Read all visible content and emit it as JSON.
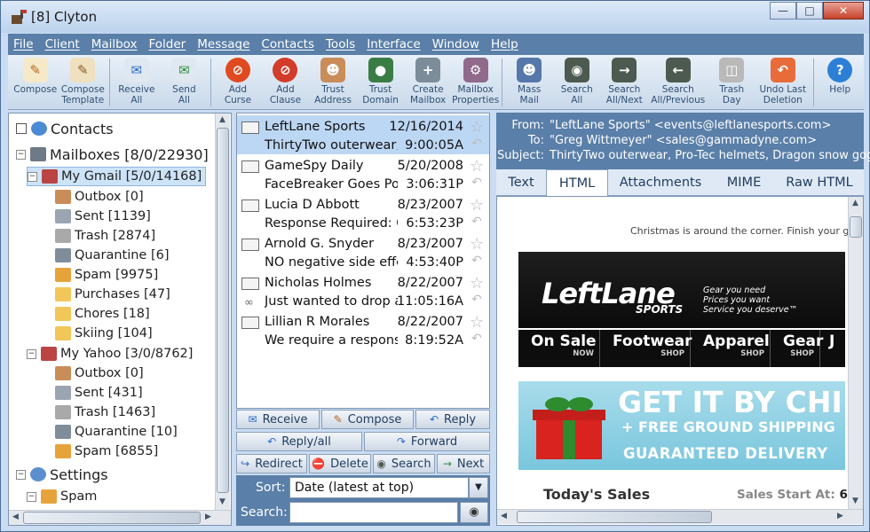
{
  "window": {
    "title": "[8] Clyton"
  },
  "menu": [
    "File",
    "Client",
    "Mailbox",
    "Folder",
    "Message",
    "Contacts",
    "Tools",
    "Interface",
    "Window",
    "Help"
  ],
  "toolbar": [
    {
      "label": "Compose",
      "icon": "compose-icon"
    },
    {
      "label": "Compose\nTemplate",
      "icon": "compose-template-icon"
    },
    {
      "label": "Receive\nAll",
      "icon": "receive-all-icon"
    },
    {
      "label": "Send\nAll",
      "icon": "send-all-icon"
    },
    {
      "label": "Add\nCurse",
      "icon": "add-curse-icon"
    },
    {
      "label": "Add\nClause",
      "icon": "add-clause-icon"
    },
    {
      "label": "Trust\nAddress",
      "icon": "trust-address-icon"
    },
    {
      "label": "Trust\nDomain",
      "icon": "trust-domain-icon"
    },
    {
      "label": "Create\nMailbox",
      "icon": "create-mailbox-icon"
    },
    {
      "label": "Mailbox\nProperties",
      "icon": "mailbox-properties-icon"
    },
    {
      "label": "Mass\nMail",
      "icon": "mass-mail-icon"
    },
    {
      "label": "Search\nAll",
      "icon": "search-all-icon"
    },
    {
      "label": "Search\nAll/Next",
      "icon": "search-next-icon"
    },
    {
      "label": "Search\nAll/Previous",
      "icon": "search-previous-icon"
    },
    {
      "label": "Trash\nDay",
      "icon": "trash-day-icon"
    },
    {
      "label": "Undo Last\nDeletion",
      "icon": "undo-deletion-icon"
    },
    {
      "label": "Help",
      "icon": "help-icon"
    }
  ],
  "tree": {
    "contacts": "Contacts",
    "mailboxes": "Mailboxes [8/0/22930]",
    "gmail": "My Gmail [5/0/14168]",
    "gmail_folders": [
      "Outbox [0]",
      "Sent [1139]",
      "Trash [2874]",
      "Quarantine [6]",
      "Spam [9975]",
      "Purchases [47]",
      "Chores [18]",
      "Skiing [104]"
    ],
    "yahoo": "My Yahoo [3/0/8762]",
    "yahoo_folders": [
      "Outbox [0]",
      "Sent [431]",
      "Trash [1463]",
      "Quarantine [10]",
      "Spam [6855]"
    ],
    "settings": "Settings",
    "settings_children": [
      "Spam"
    ]
  },
  "messages": [
    {
      "from": "LeftLane Sports",
      "date": "12/16/2014",
      "subject": "ThirtyTwo outerwear, Pro",
      "time": "9:00:05A"
    },
    {
      "from": "GameSpy Daily",
      "date": "5/20/2008",
      "subject": "FaceBreaker Goes Pow! R",
      "time": "3:06:31P"
    },
    {
      "from": "Lucia D Abbott",
      "date": "8/23/2007",
      "subject": "Response Required: Case",
      "time": "6:53:23P"
    },
    {
      "from": "Arnold G. Snyder",
      "date": "8/23/2007",
      "subject": "NO negative side effects",
      "time": "4:53:40P"
    },
    {
      "from": "Nicholas Holmes",
      "date": "8/22/2007",
      "subject": "Just wanted to drop a li",
      "time": "11:05:16A"
    },
    {
      "from": "Lillian R Morales",
      "date": "8/22/2007",
      "subject": "We require a response: R",
      "time": "8:19:52A"
    }
  ],
  "actions": {
    "receive": "Receive",
    "compose": "Compose",
    "reply": "Reply",
    "replyall": "Reply/all",
    "forward": "Forward",
    "redirect": "Redirect",
    "delete": "Delete",
    "search": "Search",
    "next": "Next"
  },
  "sort": {
    "label": "Sort:",
    "value": "Date (latest at top)",
    "search_label": "Search:"
  },
  "header": {
    "from_label": "From:",
    "from": "\"LeftLane Sports\" <events@leftlanesports.com>",
    "to_label": "To:",
    "to": "\"Greg Wittmeyer\" <sales@gammadyne.com>",
    "subject_label": "Subject:",
    "subject": "ThirtyTwo outerwear, Pro-Tec helmets, Dragon snow goggles"
  },
  "tabs": [
    "Text",
    "HTML",
    "Attachments",
    "MIME",
    "Raw HTML"
  ],
  "email": {
    "christmas": "Christmas is around the corner. Finish your gift sh",
    "logo": "LeftLane",
    "logo_sub": "SPORTS",
    "tag1": "Gear you need",
    "tag2": "Prices you want",
    "tag3": "Service you deserve™",
    "nav": [
      {
        "main": "On Sale",
        "sub": "NOW"
      },
      {
        "main": "Footwear",
        "sub": "SHOP"
      },
      {
        "main": "Apparel",
        "sub": "SHOP"
      },
      {
        "main": "Gear",
        "sub": "SHOP"
      },
      {
        "main": "J",
        "sub": ""
      }
    ],
    "promo1": "GET IT BY CHI",
    "promo2": "+ FREE GROUND SHIPPING",
    "promo3": "GUARANTEED DELIVERY",
    "todays": "Today's Sales",
    "starts": "Sales Start At:",
    "starts_val": "6:"
  }
}
